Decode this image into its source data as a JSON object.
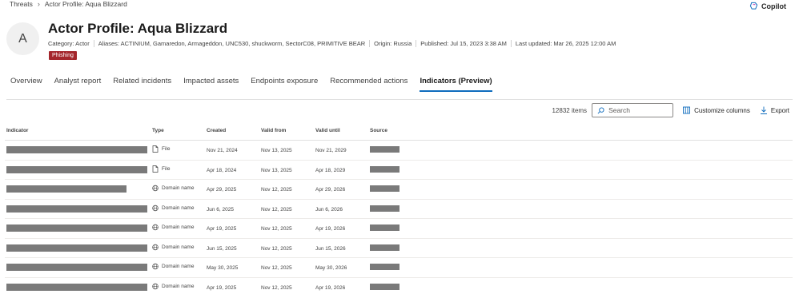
{
  "breadcrumb": {
    "items": [
      "Threats",
      "Actor Profile: Aqua Blizzard"
    ]
  },
  "copilot": {
    "label": "Copilot"
  },
  "profile": {
    "initial": "A",
    "title": "Actor Profile: Aqua Blizzard",
    "meta": [
      "Category: Actor",
      "Aliases: ACTINIUM, Gamaredon, Armageddon, UNC530, shuckworm, SectorC08, PRIMITIVE BEAR",
      "Origin: Russia",
      "Published: Jul 15, 2023 3:38 AM",
      "Last updated: Mar 26, 2025 12:00 AM"
    ],
    "tag": "Phishing"
  },
  "tabs": [
    {
      "label": "Overview",
      "active": false
    },
    {
      "label": "Analyst report",
      "active": false
    },
    {
      "label": "Related incidents",
      "active": false
    },
    {
      "label": "Impacted assets",
      "active": false
    },
    {
      "label": "Endpoints exposure",
      "active": false
    },
    {
      "label": "Recommended actions",
      "active": false
    },
    {
      "label": "Indicators (Preview)",
      "active": true
    }
  ],
  "toolbar": {
    "count": "12832 items",
    "search_placeholder": "Search",
    "customize_label": "Customize columns",
    "export_label": "Export"
  },
  "table": {
    "columns": [
      "Indicator",
      "Type",
      "Created",
      "Valid from",
      "Valid until",
      "Source"
    ],
    "rows": [
      {
        "type": "File",
        "type_icon": "file-icon",
        "created": "Nov 21, 2024",
        "valid_from": "Nov 13, 2025",
        "valid_until": "Nov 21, 2029"
      },
      {
        "type": "File",
        "type_icon": "file-icon",
        "created": "Apr 18, 2024",
        "valid_from": "Nov 13, 2025",
        "valid_until": "Apr 18, 2029"
      },
      {
        "type": "Domain name",
        "type_icon": "globe-icon",
        "created": "Apr 29, 2025",
        "valid_from": "Nov 12, 2025",
        "valid_until": "Apr 29, 2026"
      },
      {
        "type": "Domain name",
        "type_icon": "globe-icon",
        "created": "Jun 6, 2025",
        "valid_from": "Nov 12, 2025",
        "valid_until": "Jun 6, 2026"
      },
      {
        "type": "Domain name",
        "type_icon": "globe-icon",
        "created": "Apr 19, 2025",
        "valid_from": "Nov 12, 2025",
        "valid_until": "Apr 19, 2026"
      },
      {
        "type": "Domain name",
        "type_icon": "globe-icon",
        "created": "Jun 15, 2025",
        "valid_from": "Nov 12, 2025",
        "valid_until": "Jun 15, 2026"
      },
      {
        "type": "Domain name",
        "type_icon": "globe-icon",
        "created": "May 30, 2025",
        "valid_from": "Nov 12, 2025",
        "valid_until": "May 30, 2026"
      },
      {
        "type": "Domain name",
        "type_icon": "globe-icon",
        "created": "Apr 19, 2025",
        "valid_from": "Nov 12, 2025",
        "valid_until": "Apr 19, 2026"
      }
    ]
  }
}
